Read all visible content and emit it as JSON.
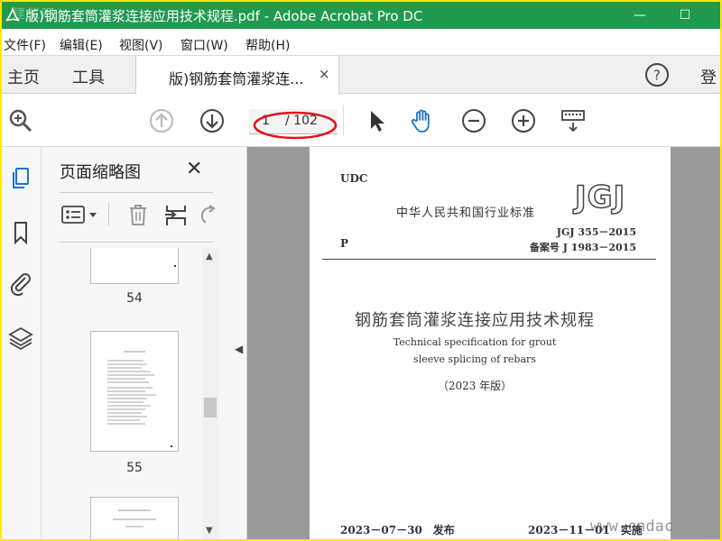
{
  "window": {
    "title": "版)钢筋套筒灌浆连接应用技术规程.pdf - Adobe Acrobat Pro DC",
    "watermark": "建筑吧",
    "minimize": "—",
    "maximize": "☐"
  },
  "menu": {
    "file": "文件(F)",
    "edit": "编辑(E)",
    "view": "视图(V)",
    "window": "窗口(W)",
    "help": "帮助(H)"
  },
  "tabs": {
    "home": "主页",
    "tools": "工具",
    "doc": "版)钢筋套筒灌浆连...",
    "doc_close": "×",
    "help_icon": "?",
    "signin": "登"
  },
  "toolbar": {
    "current_page": "1",
    "total_pages": "/ 102",
    "icons": [
      "zoom-search-icon",
      "page-up-icon",
      "page-down-icon",
      "select-arrow-icon",
      "hand-tool-icon",
      "zoom-out-icon",
      "zoom-in-icon",
      "keyboard-icon"
    ]
  },
  "panel": {
    "title": "页面缩略图",
    "close": "✕",
    "thumb_labels": [
      "54",
      "55"
    ]
  },
  "document": {
    "udc": "UDC",
    "org": "中华人民共和国行业标准",
    "jgj": "JGJ",
    "p_class": "P",
    "std_no": "JGJ 355－2015",
    "record_no": "备案号 J 1983－2015",
    "title_cn": "钢筋套筒灌浆连接应用技术规程",
    "title_en_1": "Technical specification for grout",
    "title_en_2": "sleeve splicing of rebars",
    "edition": "（2023 年版）",
    "issue_date": "2023－07－30　发布",
    "effective_date": "2023－11－01　实施"
  },
  "watermark_br": "www.cndac",
  "colors": {
    "title_bar": "#1f9a4f",
    "outer_border": "#ffe900",
    "annotation_ellipse": "#e0141a",
    "doc_background": "#9a9a9a"
  }
}
